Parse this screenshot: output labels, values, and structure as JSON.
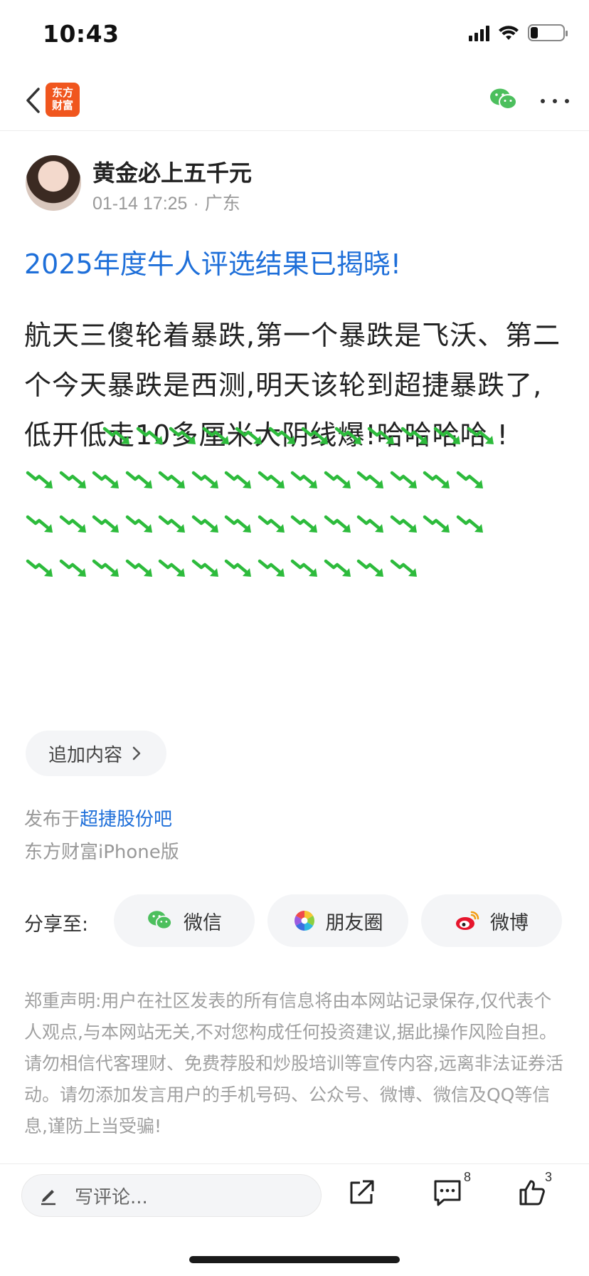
{
  "status_bar": {
    "time": "10:43"
  },
  "nav": {
    "logo_line1": "东方",
    "logo_line2": "财富",
    "back_icon": "chevron-left-icon",
    "share_icon": "wechat-icon",
    "more_icon": "more-dots-icon"
  },
  "author": {
    "name": "黄金必上五千元",
    "datetime": "01-14 17:25",
    "location": "广东"
  },
  "post": {
    "title": "2025年度牛人评选结果已揭晓!",
    "body": "航天三傻轮着暴跌,第一个暴跌是飞沃、第二个今天暴跌是西测,明天该轮到超捷暴跌了,低开低走10多厘米大阴线爆!哈哈哈哈 !",
    "emoji_count": 52,
    "emoji_icon": "green-down-arrow-icon"
  },
  "append": {
    "label": "追加内容"
  },
  "published": {
    "prefix": "发布于",
    "forum": "超捷股份吧",
    "client": "东方财富iPhone版"
  },
  "share": {
    "label": "分享至:",
    "buttons": [
      {
        "label": "微信",
        "icon": "wechat-icon"
      },
      {
        "label": "朋友圈",
        "icon": "moments-icon"
      },
      {
        "label": "微博",
        "icon": "weibo-icon"
      }
    ]
  },
  "disclaimer": "郑重声明:用户在社区发表的所有信息将由本网站记录保存,仅代表个人观点,与本网站无关,不对您构成任何投资建议,据此操作风险自担。请勿相信代客理财、免费荐股和炒股培训等宣传内容,远离非法证券活动。请勿添加发言用户的手机号码、公众号、微博、微信及QQ等信息,谨防上当受骗!",
  "bottom_bar": {
    "comment_placeholder": "写评论...",
    "comment_count": "8",
    "like_count": "3"
  },
  "colors": {
    "accent_blue": "#1e6fd9",
    "brand_orange": "#f0561e",
    "arrow_green": "#2dbb3c"
  }
}
